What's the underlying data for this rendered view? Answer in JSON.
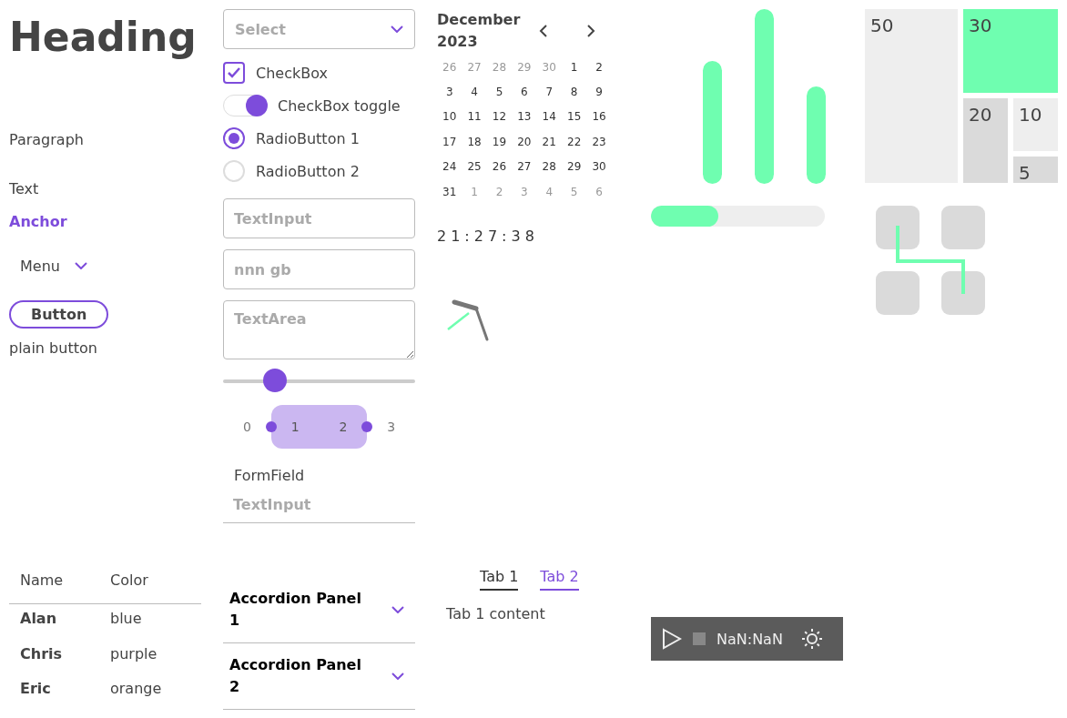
{
  "heading": "Heading",
  "paragraph": "Paragraph",
  "text": "Text",
  "anchor": "Anchor",
  "menu": {
    "label": "Menu"
  },
  "button": "Button",
  "plain_button": "plain button",
  "select": {
    "placeholder": "Select"
  },
  "checkbox": {
    "label": "CheckBox",
    "checked": true
  },
  "toggle": {
    "label": "CheckBox toggle",
    "on": true
  },
  "radios": [
    {
      "label": "RadioButton 1",
      "selected": true
    },
    {
      "label": "RadioButton 2",
      "selected": false
    }
  ],
  "text_input": {
    "placeholder": "TextInput"
  },
  "masked_input": {
    "placeholder": "nnn gb"
  },
  "text_area": {
    "placeholder": "TextArea"
  },
  "slider": {
    "level": 0.27
  },
  "range_selector": [
    {
      "label": "0",
      "selected": false
    },
    {
      "label": "1",
      "selected": true
    },
    {
      "label": "2",
      "selected": true
    },
    {
      "label": "3",
      "selected": false
    }
  ],
  "form_field": {
    "label": "FormField",
    "placeholder": "TextInput"
  },
  "calendar": {
    "title": "December 2023",
    "days": [
      {
        "label": "26",
        "outside": true
      },
      {
        "label": "27",
        "outside": true
      },
      {
        "label": "28",
        "outside": true
      },
      {
        "label": "29",
        "outside": true
      },
      {
        "label": "30",
        "outside": true
      },
      {
        "label": "1",
        "outside": false
      },
      {
        "label": "2",
        "outside": false
      },
      {
        "label": "3",
        "outside": false
      },
      {
        "label": "4",
        "outside": false
      },
      {
        "label": "5",
        "outside": false
      },
      {
        "label": "6",
        "outside": false
      },
      {
        "label": "7",
        "outside": false
      },
      {
        "label": "8",
        "outside": false
      },
      {
        "label": "9",
        "outside": false
      },
      {
        "label": "10",
        "outside": false
      },
      {
        "label": "11",
        "outside": false
      },
      {
        "label": "12",
        "outside": false
      },
      {
        "label": "13",
        "outside": false
      },
      {
        "label": "14",
        "outside": false
      },
      {
        "label": "15",
        "outside": false
      },
      {
        "label": "16",
        "outside": false
      },
      {
        "label": "17",
        "outside": false
      },
      {
        "label": "18",
        "outside": false
      },
      {
        "label": "19",
        "outside": false
      },
      {
        "label": "20",
        "outside": false
      },
      {
        "label": "21",
        "outside": false
      },
      {
        "label": "22",
        "outside": false
      },
      {
        "label": "23",
        "outside": false
      },
      {
        "label": "24",
        "outside": false
      },
      {
        "label": "25",
        "outside": false
      },
      {
        "label": "26",
        "outside": false
      },
      {
        "label": "27",
        "outside": false
      },
      {
        "label": "28",
        "outside": false
      },
      {
        "label": "29",
        "outside": false
      },
      {
        "label": "30",
        "outside": false
      },
      {
        "label": "31",
        "outside": false
      },
      {
        "label": "1",
        "outside": true
      },
      {
        "label": "2",
        "outside": true
      },
      {
        "label": "3",
        "outside": true
      },
      {
        "label": "4",
        "outside": true
      },
      {
        "label": "5",
        "outside": true
      },
      {
        "label": "6",
        "outside": true
      }
    ]
  },
  "clock": {
    "time": "21:27:38"
  },
  "meter": {
    "level": 0.39
  },
  "treemap": [
    {
      "label": "50",
      "color": "#eeeeee"
    },
    {
      "label": "30",
      "color": "#6ffeb0"
    },
    {
      "label": "20",
      "color": "#dadada"
    },
    {
      "label": "10",
      "color": "#eeeeee"
    },
    {
      "label": "5",
      "color": "#dadada"
    }
  ],
  "table": {
    "columns": [
      "Name",
      "Color"
    ],
    "rows": [
      [
        "Alan",
        "blue"
      ],
      [
        "Chris",
        "purple"
      ],
      [
        "Eric",
        "orange"
      ]
    ]
  },
  "accordion": [
    {
      "label": "Accordion Panel 1",
      "expanded": false
    },
    {
      "label": "Accordion Panel 2",
      "expanded": false
    }
  ],
  "tabs": [
    {
      "label": "Tab 1",
      "selected": true
    },
    {
      "label": "Tab 2",
      "selected": false
    }
  ],
  "tab_content": "Tab 1 content",
  "video": {
    "time": "NaN:NaN"
  }
}
